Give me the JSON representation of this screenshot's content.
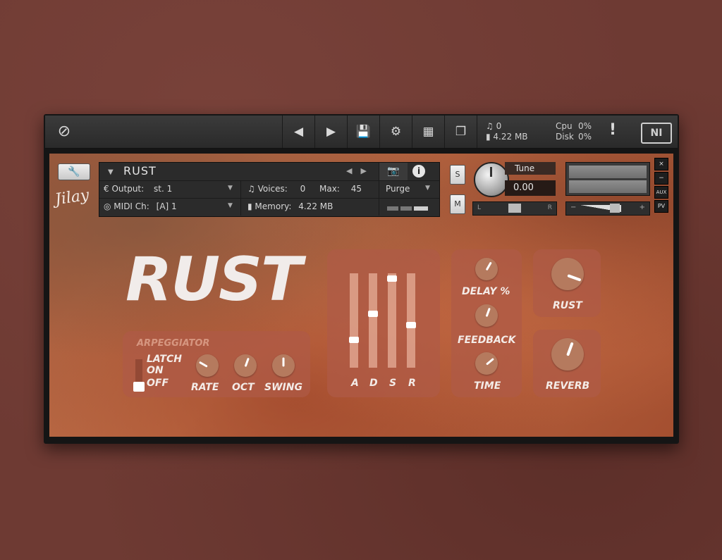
{
  "toolbar": {
    "voices": "0",
    "memory": "4.22 MB",
    "cpu_label": "Cpu",
    "cpu_value": "0%",
    "disk_label": "Disk",
    "disk_value": "0%",
    "warning": "!",
    "ni_logo": "NI"
  },
  "header": {
    "instrument_name": "RUST",
    "output_label": "Output:",
    "output_value": "st. 1",
    "midi_label": "MIDI Ch:",
    "midi_value": "[A] 1",
    "voices_label": "Voices:",
    "voices_value": "0",
    "max_label": "Max:",
    "max_value": "45",
    "memory_label": "Memory:",
    "memory_value": "4.22 MB",
    "purge_label": "Purge",
    "solo": "S",
    "mute": "M",
    "tune_label": "Tune",
    "tune_value": "0.00",
    "pan_left": "L",
    "pan_right": "R",
    "vol_minus": "−",
    "vol_plus": "+",
    "close": "×",
    "minimize": "−",
    "aux": "AUX",
    "pv": "PV",
    "signature": "Jilay"
  },
  "main": {
    "logo": "RUST",
    "arpeggiator": {
      "title": "ARPEGGIATOR",
      "latch": "LATCH",
      "on": "ON",
      "off": "OFF",
      "rate": "RATE",
      "oct": "OCT",
      "swing": "SWING"
    },
    "envelope": {
      "a": "A",
      "d": "D",
      "s": "S",
      "r": "R",
      "levels": {
        "a": 0.28,
        "d": 0.58,
        "s": 0.98,
        "r": 0.45
      }
    },
    "delay": {
      "delay_pct": "DELAY %",
      "feedback": "FEEDBACK",
      "time": "TIME"
    },
    "rust_knob": "RUST",
    "reverb": "REVERB"
  },
  "colors": {
    "accent": "#c06c45",
    "panel": "#af5a46",
    "frame": "#151515"
  },
  "icons": [
    "kontakt-logo-icon",
    "prev-icon",
    "next-icon",
    "save-icon",
    "gear-icon",
    "layout-icon",
    "resize-icon",
    "wrench-icon",
    "camera-icon",
    "info-icon",
    "dropdown-icon"
  ]
}
